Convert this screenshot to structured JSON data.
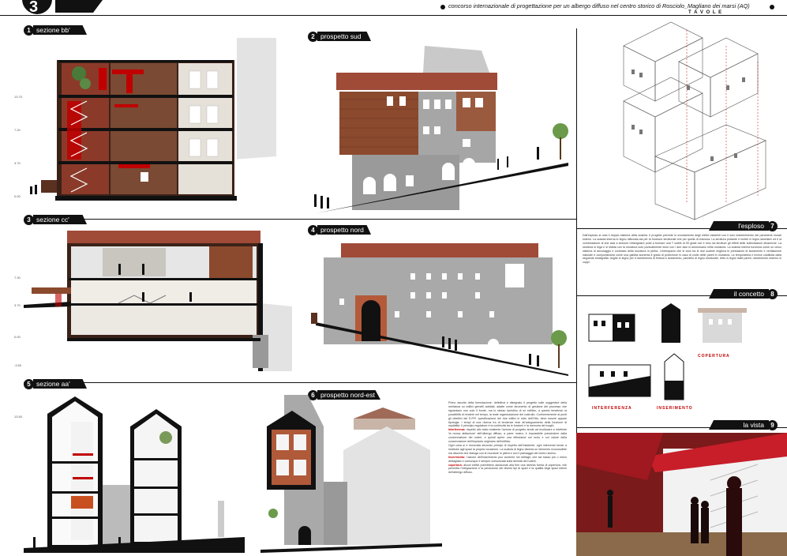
{
  "header": {
    "page_number": "3",
    "title_text": "concorso internazionale di progettazione per un albergo diffuso nel centro storico di Rosciolo_Magliano dei marsi (AQ)",
    "tavole": "T A V O L E"
  },
  "sections": [
    {
      "num": "1",
      "label": "sezione bb'"
    },
    {
      "num": "2",
      "label": "prospetto sud"
    },
    {
      "num": "3",
      "label": "sezione cc'"
    },
    {
      "num": "4",
      "label": "prospetto nord"
    },
    {
      "num": "5",
      "label": "sezione aa'"
    },
    {
      "num": "6",
      "label": "prospetto nord-est"
    },
    {
      "num": "7",
      "label": "l'esploso"
    },
    {
      "num": "8",
      "label": "il concetto"
    },
    {
      "num": "9",
      "label": "la vista"
    }
  ],
  "levels": {
    "sec1": [
      "13.70",
      "7.20",
      "3.70",
      "0.00"
    ],
    "sec3": [
      "7.30",
      "3.70",
      "0.00",
      "-3.50"
    ],
    "sec5": [
      "13.50"
    ]
  },
  "concept": {
    "copertura": "COPERTURA",
    "interferenza": "INTERFERENZA",
    "inserimento": "INSERIMENTO"
  },
  "text": {
    "esploso_paragraph": "Dall'esploso si nota il doppio sistema della scatola. Il progetto prevede lo svuotamento degli edifici esistenti con il solo mantenimento dei paramenti murari esterni. La scatola interna in legno utilizzata sia per la funzione strutturale che per quella di chiusura. La struttura portante è inoltre in legno lamellare ed è la combinazione di due assi a sezione rettangolare posti a formare una T sottile di 90 gradi ove è reso da strutture gli effetti delle sollecitazioni dinamiche. La struttura si lega e si sfalda con la muratura solo puntualmente dove con i due assi si ammorsano nella muratura. La scatola interna funziona come un unico sistema di ancoraggio e contrasto della muratura in pietra. L'interspazio che si crea tra le due scatole migliora le prestazioni di isolamento e ventilazione naturale e comportandosi come una gabbia aumenta il grado di protezione in caso di crollo delle pareti in muratura. La temporanea e invece costituita dalla seguente stratigrafia: doghe in legno per il rivestimento di finitura e isolamento, pannello di legno strutturale, tetto in legno dalle pareti, rivestimento esterno in coppi.",
    "main_paragraph_1": "Primo ascolto della formulazione: definitiva e disegnato il progetto sulle suggestive della merlatura su edifici gemelli adottati, adatte come strumento di gestione del processo che riguardano non solo il fronte, ma lo stesso ripristino di un edificio, a questo tendendo la possibilità di rendere nel tempo, la reale organizzazione del costruito. Conformemente ai punti gli obiettivi del D.P.R. specificazione dei due edifici in tutto dell'Otto, deve essere appare tipologia. I tempi di una ricerca tra di tendenze tese all'adeguamento della funzione di ospitalità. Il principio regolatore è la continuità tra le funzioni e la memoria dei luoghi.",
    "interferenza_label": "Interferenza:",
    "interferenza_text": "rispetto allo stato esistente l'azione di progetto tende ad ricollocare e ridefinire 'la nuova abitazione' dell'albergo diffuso, a parer nostro, è impossibile prescindere dalla conservazione dei ruderi, e quindi aprire una riflessione sul ruolo e sul valore della conservazione dell'impianto originario dell'edificio.",
    "main_paragraph_2": "Ogni cosa si è rinnovata secondo principi di rispetto dell'esistente; ogni intervento tende a restituire agli spazi la propria vocazione. La scatola di legno diventa un elemento riconoscibile ma discreto che dialoga con le murature in pietra e con il paesaggio del centro storico.",
    "inserimento_label": "Inserimento:",
    "inserimento_text": "l'azione dell'inserimento può avvenire nei dettagli; che sia basso più o meno dettagliato e comunque è sempre comunicata sulla densità del rudere.",
    "copertura_label": "copertura:",
    "copertura_text": "alcuni edifici potrebbero assicurare alla fine una diversa forma di copertura, che permetta l'integrazione e la percezione dei diversi tipi di spazi e la qualità degli spazi interni dell'albergo diffuso."
  },
  "colors": {
    "ink": "#111111",
    "accent_red": "#c00000",
    "wood": "#8b4a2e",
    "roof": "#a04a38",
    "stone": "#9a9a9a"
  }
}
